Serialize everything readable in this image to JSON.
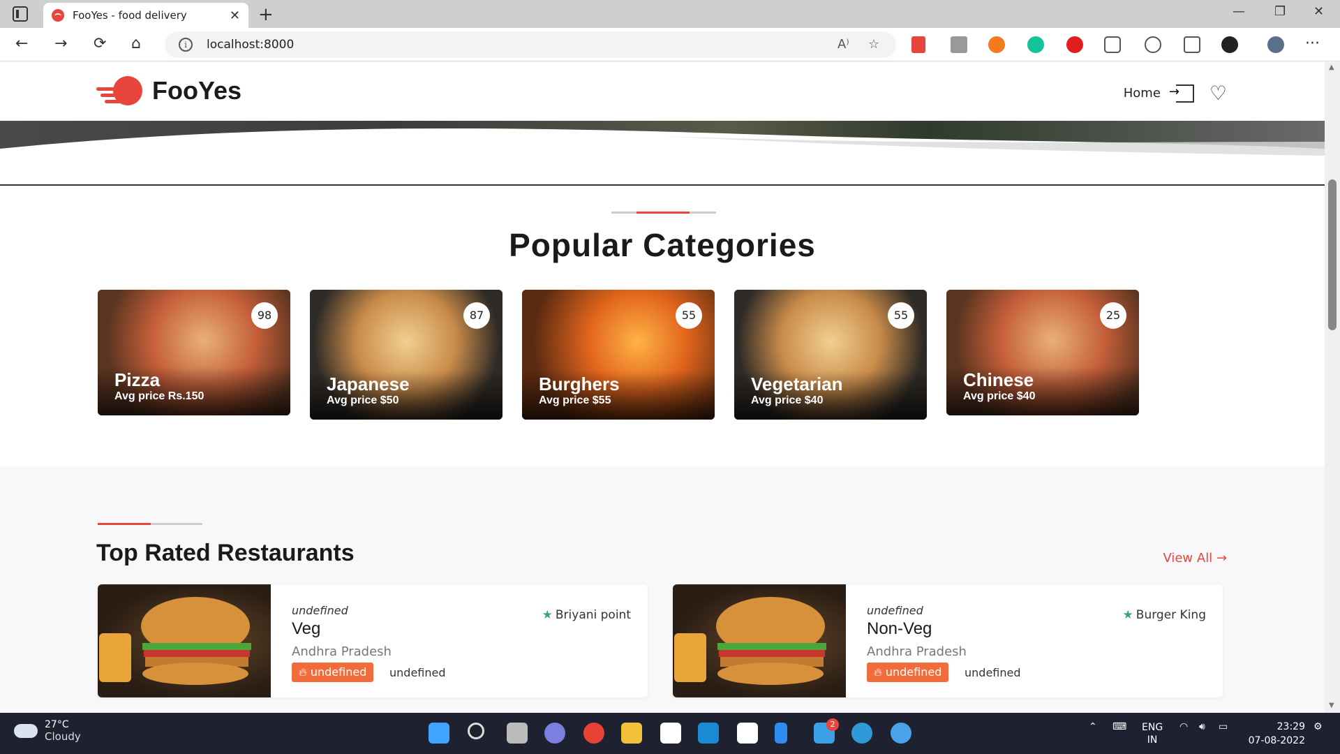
{
  "browser": {
    "tab_title": "FooYes - food delivery",
    "tab_close": "✕",
    "new_tab": "+",
    "url": "localhost:8000",
    "win_min": "—",
    "win_max": "❐",
    "win_close": "✕",
    "nav_back": "←",
    "nav_forward": "→",
    "nav_reload": "⟳",
    "nav_home": "⌂",
    "more": "···",
    "read_aloud": "A⁾",
    "favorite_add": "☆"
  },
  "site": {
    "logo_text": "FooYes",
    "nav_home": "Home",
    "brand_color": "#e8453c"
  },
  "popular": {
    "title": "Popular Categories",
    "categories": [
      {
        "name": "Pizza",
        "price": "Avg price Rs.150",
        "count": "98"
      },
      {
        "name": "Japanese",
        "price": "Avg price $50",
        "count": "87"
      },
      {
        "name": "Burghers",
        "price": "Avg price $55",
        "count": "55"
      },
      {
        "name": "Vegetarian",
        "price": "Avg price $40",
        "count": "55"
      },
      {
        "name": "Chinese",
        "price": "Avg price $40",
        "count": "25"
      }
    ]
  },
  "restaurants": {
    "title": "Top Rated Restaurants",
    "view_all": "View All →",
    "items": [
      {
        "meta": "undefined",
        "name": "Veg",
        "location": "Andhra Pradesh",
        "tag": "undefined",
        "tag_extra": "undefined",
        "restaurant": "Briyani point"
      },
      {
        "meta": "undefined",
        "name": "Non-Veg",
        "location": "Andhra Pradesh",
        "tag": "undefined",
        "tag_extra": "undefined",
        "restaurant": "Burger King"
      }
    ]
  },
  "taskbar": {
    "temp": "27°C",
    "weather": "Cloudy",
    "lang1": "ENG",
    "lang2": "IN",
    "time": "23:29",
    "date": "07-08-2022",
    "mail_badge": "2"
  }
}
